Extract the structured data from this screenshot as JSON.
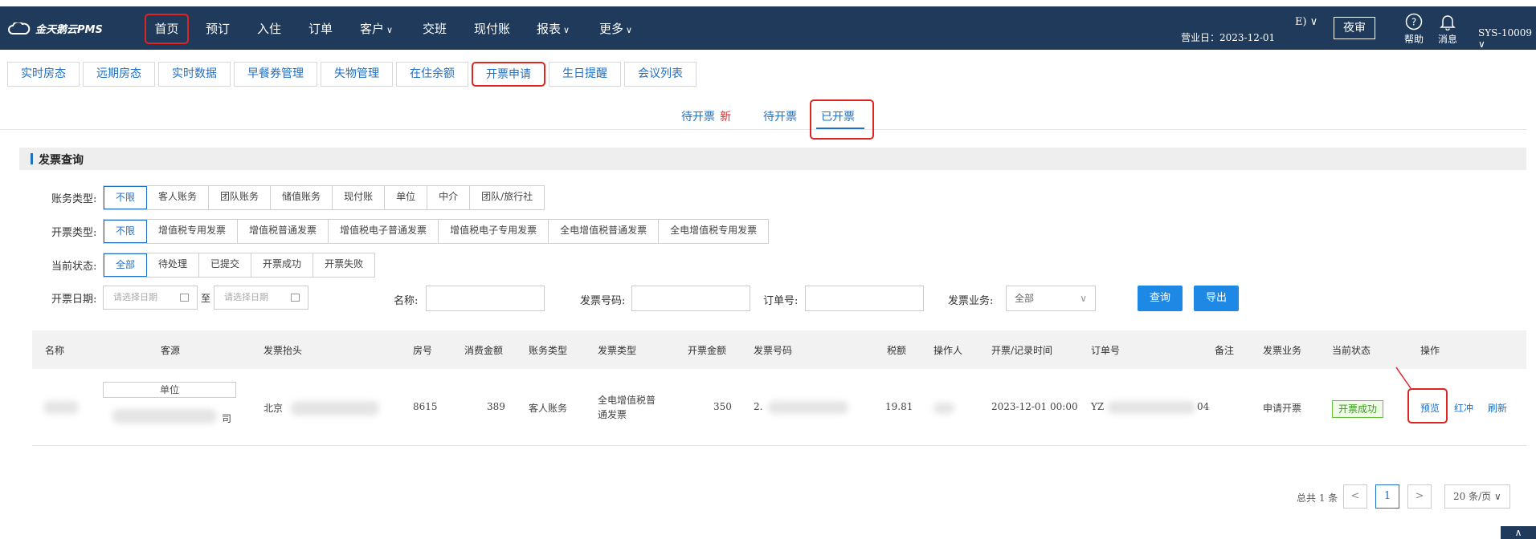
{
  "topbar": {
    "logo_text": "金天鹅云PMS",
    "nav": [
      {
        "label": "首页",
        "dropdown": false
      },
      {
        "label": "预订",
        "dropdown": false
      },
      {
        "label": "入住",
        "dropdown": false
      },
      {
        "label": "订单",
        "dropdown": false
      },
      {
        "label": "客户",
        "dropdown": true
      },
      {
        "label": "交班",
        "dropdown": false
      },
      {
        "label": "现付账",
        "dropdown": false
      },
      {
        "label": "报表",
        "dropdown": true
      },
      {
        "label": "更多",
        "dropdown": true
      }
    ],
    "business_date": "营业日：2023-12-01",
    "mode_fragment": "E) ∨",
    "night_audit": "夜审",
    "help": "帮助",
    "messages": "消息",
    "user": "SYS-10009 ∨",
    "icons": [
      "help-circle-icon",
      "bell-icon",
      "cloud-logo-icon"
    ]
  },
  "subtabs": [
    "实时房态",
    "远期房态",
    "实时数据",
    "早餐券管理",
    "失物管理",
    "在住余额",
    "开票申请",
    "生日提醒",
    "会议列表"
  ],
  "status_tabs": {
    "pending_new": "待开票",
    "new_badge": "新",
    "pending": "待开票",
    "issued": "已开票"
  },
  "section_title": "发票查询",
  "filters": {
    "account_type": {
      "label": "账务类型:",
      "options": [
        "不限",
        "客人账务",
        "团队账务",
        "储值账务",
        "现付账",
        "单位",
        "中介",
        "团队/旅行社"
      ],
      "selected": "不限"
    },
    "invoice_type": {
      "label": "开票类型:",
      "options": [
        "不限",
        "增值税专用发票",
        "增值税普通发票",
        "增值税电子普通发票",
        "增值税电子专用发票",
        "全电增值税普通发票",
        "全电增值税专用发票"
      ],
      "selected": "不限"
    },
    "current_state": {
      "label": "当前状态:",
      "options": [
        "全部",
        "待处理",
        "已提交",
        "开票成功",
        "开票失败"
      ],
      "selected": "全部"
    },
    "date_label": "开票日期:",
    "date_placeholder": "请选择日期",
    "to": "至",
    "name_label": "名称:",
    "invoice_no_label": "发票号码:",
    "order_no_label": "订单号:",
    "biz_label": "发票业务:",
    "biz_value": "全部",
    "query_button": "查询",
    "export_button": "导出"
  },
  "table": {
    "columns": [
      "名称",
      "客源",
      "发票抬头",
      "房号",
      "消费金额",
      "账务类型",
      "发票类型",
      "开票金额",
      "发票号码",
      "税额",
      "操作人",
      "开票/记录时间",
      "订单号",
      "备注",
      "发票业务",
      "当前状态",
      "操作"
    ],
    "rows": [
      {
        "name": "(redacted)",
        "source_tag": "单位",
        "source_name": "司",
        "title_fragment": "北京",
        "room": "8615",
        "consumption": "389",
        "account_type": "客人账务",
        "invoice_type": "全电增值税普通发票",
        "amount": "350",
        "invoice_no_fragment": "2.",
        "tax": "19.81",
        "operator": "",
        "time": "2023-12-01 00:00",
        "order_no_prefix": "YZ",
        "order_no_suffix": "04",
        "remark": "",
        "business": "申请开票",
        "state": "开票成功",
        "actions": [
          "预览",
          "红冲",
          "刷新"
        ]
      }
    ]
  },
  "pagination": {
    "total": "总共 1 条",
    "prev": "<",
    "current_page": "1",
    "next": ">",
    "page_size": "20 条/页 ∨"
  },
  "fab_icon": "chevron-up-icon"
}
